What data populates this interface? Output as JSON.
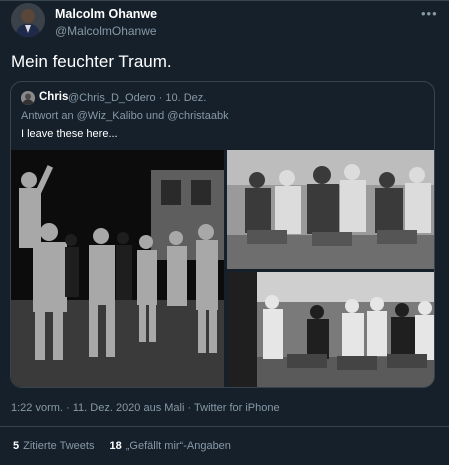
{
  "author": {
    "name": "Malcolm Ohanwe",
    "handle": "@MalcolmOhanwe"
  },
  "more_icon": "ellipsis-icon",
  "tweet": {
    "text": "Mein feuchter Traum."
  },
  "quoted": {
    "name": "Chris",
    "handle_date": "@Chris_D_Odero · 10. Dez.",
    "reply_to": "Antwort an @Wiz_Kalibo und @christaabk",
    "text": "I leave these here..."
  },
  "meta": {
    "timestamp": "1:22 vorm. · 11. Dez. 2020 aus Mali · Twitter for iPhone"
  },
  "stats": {
    "quotes_count": "5",
    "quotes_label": "Zitierte Tweets",
    "likes_count": "18",
    "likes_label": "„Gefällt mir“-Angaben"
  }
}
